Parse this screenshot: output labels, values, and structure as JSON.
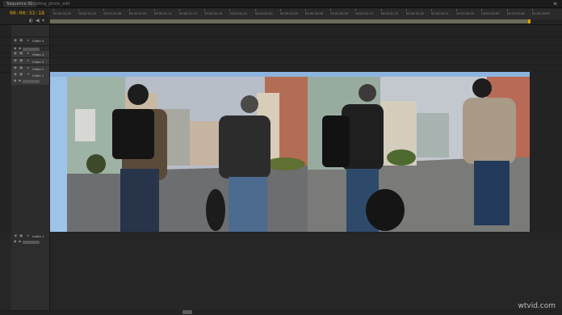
{
  "tabs": {
    "active": "Sequence 01",
    "second": "shooting_photo_edit",
    "close": "≡"
  },
  "timecode": "00:00:33:18",
  "ruler_ticks": [
    "00:00:31:00",
    "00:00:31:03",
    "00:00:31:06",
    "00:00:31:09",
    "00:00:31:12",
    "00:00:31:15",
    "00:00:31:18",
    "00:00:31:21",
    "00:00:32:00",
    "00:00:32:03",
    "00:00:32:06",
    "00:00:32:09",
    "00:00:32:12",
    "00:00:32:15",
    "00:00:32:18",
    "00:00:32:21",
    "00:00:33:00",
    "00:00:33:03",
    "00:00:33:06",
    "00:00:33:09"
  ],
  "tracks": {
    "video": [
      "Video 4",
      "Video 4",
      "Video 3",
      "Video 2",
      "Video 1"
    ],
    "audio": [
      "Audio 1"
    ]
  },
  "tool_icons": [
    "snap-icon",
    "marker-icon",
    "keyframe-icon"
  ],
  "watermark": "wtvid.com"
}
